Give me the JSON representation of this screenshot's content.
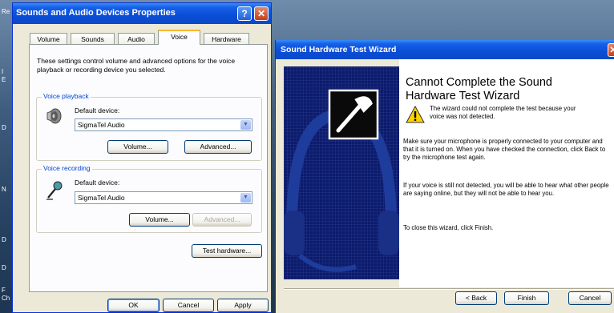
{
  "desktop": {
    "labels": [
      "Re",
      "I",
      "E",
      "D",
      "N",
      "D",
      "D",
      "F",
      "Ch"
    ]
  },
  "props": {
    "title": "Sounds and Audio Devices Properties",
    "help": "?",
    "close": "✕",
    "tabs": [
      "Volume",
      "Sounds",
      "Audio",
      "Voice",
      "Hardware"
    ],
    "selected_tab": "Voice",
    "intro": "These settings control volume and advanced options for the voice playback or recording device you selected.",
    "playback": {
      "legend": "Voice playback",
      "device_label": "Default device:",
      "device": "SigmaTel Audio",
      "volume": "Volume...",
      "advanced": "Advanced..."
    },
    "recording": {
      "legend": "Voice recording",
      "device_label": "Default device:",
      "device": "SigmaTel Audio",
      "volume": "Volume...",
      "advanced": "Advanced..."
    },
    "test_hardware": "Test hardware...",
    "ok": "OK",
    "cancel": "Cancel",
    "apply": "Apply"
  },
  "wizard": {
    "title": "Sound Hardware Test Wizard",
    "close": "✕",
    "heading": "Cannot Complete the Sound Hardware Test Wizard",
    "warning": "The wizard could not complete the test because your voice was not detected.",
    "para1": "Make sure your microphone is properly connected to your computer and that it is turned on. When you have checked the connection, click Back to try the microphone test again.",
    "para2": "If your voice is still not detected, you will be able to hear what other people are saying online, but they will not be able to hear you.",
    "para3": "To close this wizard, click Finish.",
    "back": "< Back",
    "finish": "Finish",
    "cancel": "Cancel"
  }
}
